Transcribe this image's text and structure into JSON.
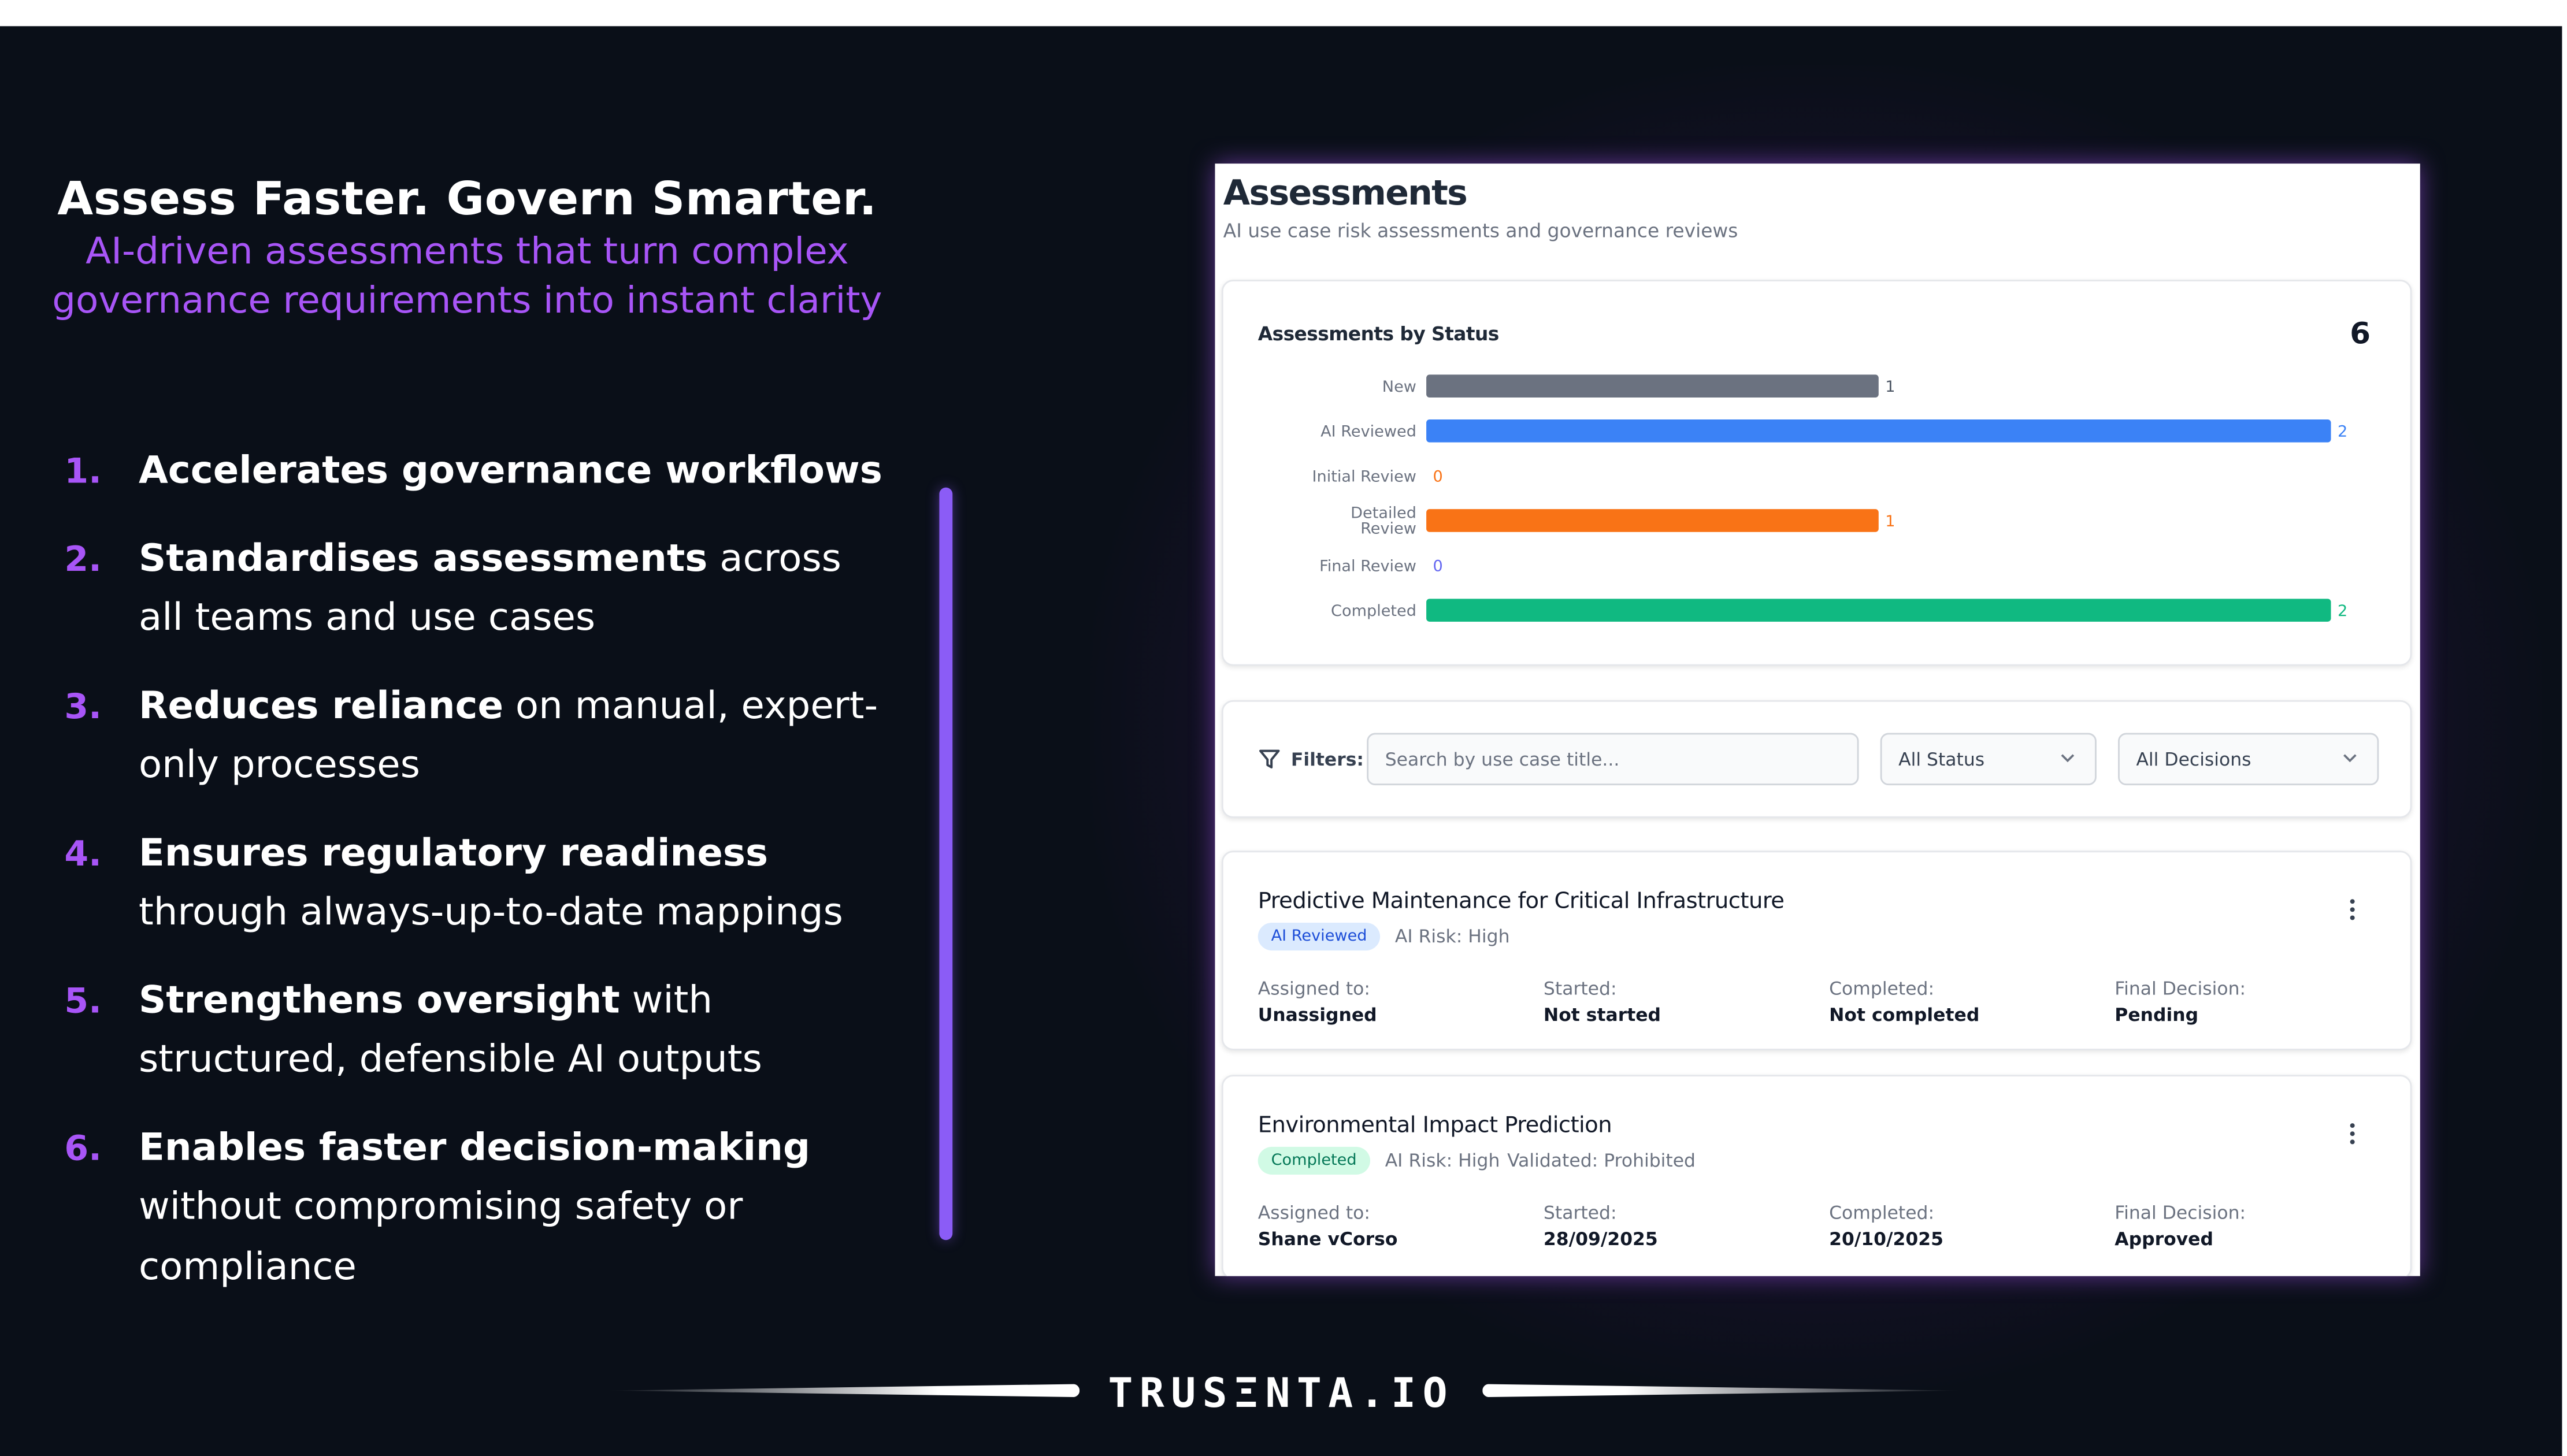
{
  "headline": {
    "title": "Assess Faster. Govern Smarter.",
    "subtitle_line1": "AI-driven assessments that turn complex",
    "subtitle_line2": "governance requirements into instant clarity"
  },
  "benefits": [
    {
      "number": "1.",
      "bold": "Accelerates governance workflows",
      "rest": "",
      "line2": ""
    },
    {
      "number": "2.",
      "bold": "Standardises assessments",
      "rest": " across",
      "line2": "all teams and use cases"
    },
    {
      "number": "3.",
      "bold": "Reduces reliance",
      "rest": " on manual, expert-",
      "line2": "only processes"
    },
    {
      "number": "4.",
      "bold": "Ensures regulatory readiness",
      "rest": "",
      "line2": "through always-up-to-date mappings"
    },
    {
      "number": "5.",
      "bold": "Strengthens oversight",
      "rest": " with",
      "line2": "structured, defensible AI outputs"
    },
    {
      "number": "6.",
      "bold": "Enables faster decision-making",
      "rest": "",
      "line2": "without compromising safety or",
      "line3": "compliance"
    }
  ],
  "footer": {
    "brand": "TRUSΞNTA.IO"
  },
  "app": {
    "title": "Assessments",
    "subtitle": "AI use case risk assessments and governance reviews",
    "filters": {
      "label": "Filters:",
      "search_placeholder": "Search by use case title...",
      "status_value": "All Status",
      "decision_value": "All Decisions"
    },
    "rows": [
      {
        "title": "Predictive Maintenance for Critical Infrastructure",
        "status": "AI Reviewed",
        "risk": "AI Risk: High",
        "validated": "",
        "assigned_label": "Assigned to:",
        "assigned": "Unassigned",
        "started_label": "Started:",
        "started": "Not started",
        "completed_label": "Completed:",
        "completed": "Not completed",
        "decision_label": "Final Decision:",
        "decision": "Pending"
      },
      {
        "title": "Environmental Impact Prediction",
        "status": "Completed",
        "risk": "AI Risk: High",
        "validated": "Validated: Prohibited",
        "assigned_label": "Assigned to:",
        "assigned": "Shane vCorso",
        "started_label": "Started:",
        "started": "28/09/2025",
        "completed_label": "Completed:",
        "completed": "20/10/2025",
        "decision_label": "Final Decision:",
        "decision": "Approved"
      }
    ]
  },
  "chart_data": {
    "type": "bar",
    "orientation": "horizontal",
    "title": "Assessments by Status",
    "total": "6",
    "categories": [
      "New",
      "AI Reviewed",
      "Initial Review",
      "Detailed Review",
      "Final Review",
      "Completed"
    ],
    "values": [
      1,
      2,
      0,
      1,
      0,
      2
    ],
    "colors": [
      "#6b7280",
      "#3b82f6",
      "#f97316",
      "#f97316",
      "#6366f1",
      "#10b981"
    ],
    "label_colors": [
      "#4b5563",
      "#3b82f6",
      "#f97316",
      "#f97316",
      "#6366f1",
      "#10b981"
    ],
    "xlim": [
      0,
      2
    ],
    "grid": false,
    "legend": "none"
  },
  "colors": {
    "accent": "#a855f7",
    "background": "#0a0f18",
    "bar_divider": "#8b5cf6"
  }
}
